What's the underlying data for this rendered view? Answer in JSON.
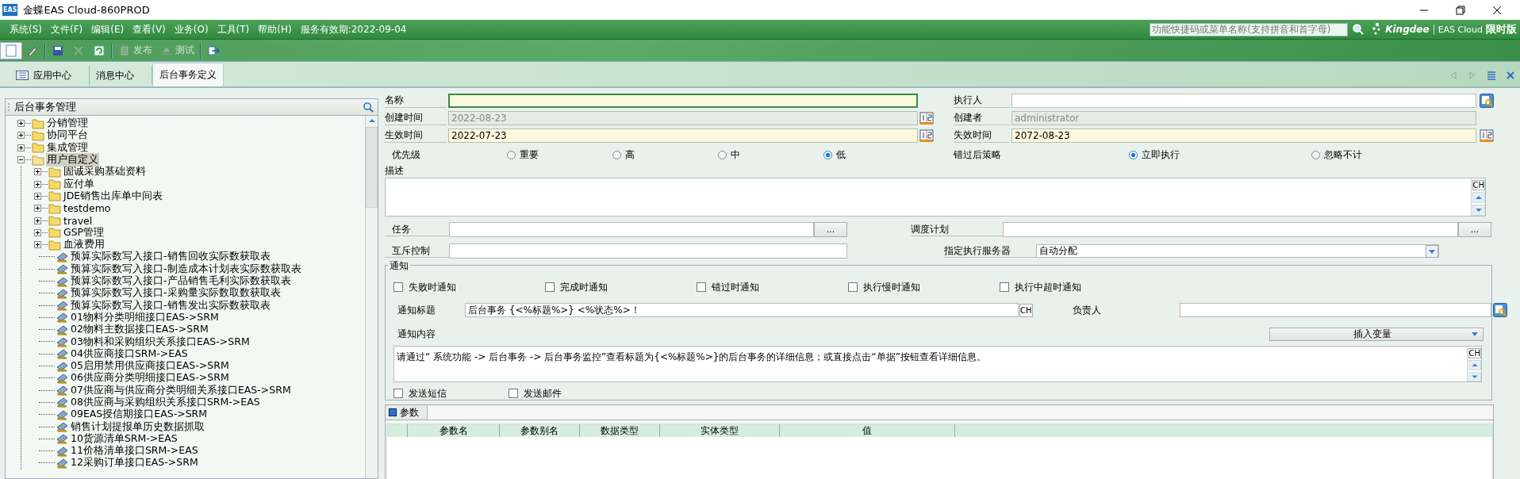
{
  "window": {
    "logo": "EAS",
    "title": "金蝶EAS Cloud-860PROD"
  },
  "menu": [
    "系统(S)",
    "文件(F)",
    "编辑(E)",
    "查看(V)",
    "业务(O)",
    "工具(T)",
    "帮助(H)"
  ],
  "service_expiry": "服务有效期:2022-09-04",
  "quick_search": {
    "placeholder": "功能快捷码或菜单名称(支持拼音和首字母)"
  },
  "brand": {
    "name": "Kingdee",
    "product": "EAS Cloud",
    "edition": "限时版"
  },
  "toolbar": [
    {
      "kind": "new",
      "disabled": false
    },
    {
      "kind": "edit",
      "disabled": false
    },
    {
      "kind": "save",
      "disabled": false
    },
    {
      "kind": "delete",
      "disabled": true
    },
    {
      "kind": "refresh",
      "disabled": false
    },
    {
      "kind": "publish",
      "label": "发布",
      "disabled": true
    },
    {
      "kind": "test",
      "label": "测试",
      "disabled": true
    },
    {
      "kind": "exit",
      "disabled": false
    }
  ],
  "tabs": [
    {
      "label": "应用中心",
      "kind": "app",
      "selected": false
    },
    {
      "label": "消息中心",
      "kind": "plain",
      "selected": false
    },
    {
      "label": "后台事务定义",
      "kind": "plain",
      "selected": true
    }
  ],
  "tree": {
    "title": "后台事务管理",
    "items": [
      {
        "label": "分销管理",
        "kind": "folder",
        "expanded": false,
        "selected": false
      },
      {
        "label": "协同平台",
        "kind": "folder",
        "expanded": false,
        "selected": false
      },
      {
        "label": "集成管理",
        "kind": "folder",
        "expanded": false,
        "selected": false
      },
      {
        "label": "用户自定义",
        "kind": "folder",
        "expanded": true,
        "selected": true,
        "children": [
          {
            "label": "固诚采购基础资料",
            "kind": "folder",
            "expanded": false,
            "selected": false
          },
          {
            "label": "应付单",
            "kind": "folder",
            "expanded": false,
            "selected": false
          },
          {
            "label": "JDE销售出库单中间表",
            "kind": "folder",
            "expanded": false,
            "selected": false
          },
          {
            "label": "testdemo",
            "kind": "folder",
            "expanded": false,
            "selected": false
          },
          {
            "label": "travel",
            "kind": "folder",
            "expanded": false,
            "selected": false
          },
          {
            "label": "GSP管理",
            "kind": "folder",
            "expanded": false,
            "selected": false
          },
          {
            "label": "血液费用",
            "kind": "folder",
            "expanded": false,
            "selected": false
          },
          {
            "label": "预算实际数写入接口-销售回收实际数获取表",
            "kind": "task",
            "selected": false
          },
          {
            "label": "预算实际数写入接口-制造成本计划表实际数获取表",
            "kind": "task",
            "selected": false
          },
          {
            "label": "预算实际数写入接口-产品销售毛利实际数获取表",
            "kind": "task",
            "selected": false
          },
          {
            "label": "预算实际数写入接口-采购量实际数取数获取表",
            "kind": "task",
            "selected": false
          },
          {
            "label": "预算实际数写入接口-销售发出实际数获取表",
            "kind": "task",
            "selected": false
          },
          {
            "label": "01物料分类明细接口EAS->SRM",
            "kind": "task",
            "selected": false
          },
          {
            "label": "02物料主数据接口EAS->SRM",
            "kind": "task",
            "selected": false
          },
          {
            "label": "03物料和采购组织关系接口EAS->SRM",
            "kind": "task",
            "selected": false
          },
          {
            "label": "04供应商接口SRM->EAS",
            "kind": "task",
            "selected": false
          },
          {
            "label": "05启用禁用供应商接口EAS->SRM",
            "kind": "task",
            "selected": false
          },
          {
            "label": "06供应商分类明细接口EAS->SRM",
            "kind": "task",
            "selected": false
          },
          {
            "label": "07供应商与供应商分类明细关系接口EAS->SRM",
            "kind": "task",
            "selected": false
          },
          {
            "label": "08供应商与采购组织关系接口SRM->EAS",
            "kind": "task",
            "selected": false
          },
          {
            "label": "09EAS授信期接口EAS->SRM",
            "kind": "task",
            "selected": false
          },
          {
            "label": "销售计划提报单历史数据抓取",
            "kind": "task",
            "selected": false
          },
          {
            "label": "10货源清单SRM->EAS",
            "kind": "task",
            "selected": false
          },
          {
            "label": "11价格清单接口SRM->EAS",
            "kind": "task",
            "selected": false
          },
          {
            "label": "12采购订单接口EAS->SRM",
            "kind": "task",
            "selected": false
          }
        ]
      }
    ]
  },
  "form": {
    "fields_left": [
      {
        "label": "名称",
        "kind": "text",
        "required": true,
        "readonly": false
      },
      {
        "label": "创建时间",
        "value": "2022-08-23",
        "kind": "date",
        "required": false,
        "readonly": true
      },
      {
        "label": "生效时间",
        "value": "2022-07-23",
        "kind": "date",
        "required": true,
        "readonly": false
      }
    ],
    "fields_right": [
      {
        "label": "执行人",
        "kind": "lookup",
        "required": false,
        "readonly": false
      },
      {
        "label": "创建者",
        "value": "administrator",
        "kind": "text",
        "required": false,
        "readonly": true
      },
      {
        "label": "失效时间",
        "value": "2072-08-23",
        "kind": "date",
        "required": true,
        "readonly": false
      }
    ],
    "priority": {
      "label": "优先级",
      "options": [
        {
          "label": "重要",
          "selected": false
        },
        {
          "label": "高",
          "selected": false
        },
        {
          "label": "中",
          "selected": false
        },
        {
          "label": "低",
          "selected": true
        }
      ]
    },
    "missed_policy": {
      "label": "错过后策略",
      "options": [
        {
          "label": "立即执行",
          "selected": true
        },
        {
          "label": "忽略不计",
          "selected": false
        }
      ]
    },
    "description": {
      "label": "描述",
      "lang_button": "CH"
    },
    "task": {
      "label": "任务",
      "button": "..."
    },
    "mutex": {
      "label": "互斥控制"
    },
    "schedule": {
      "label": "调度计划",
      "button": "..."
    },
    "server": {
      "label": "指定执行服务器",
      "value": "自动分配"
    }
  },
  "notify": {
    "title": "通知",
    "events": [
      {
        "label": "失败时通知",
        "checked": false
      },
      {
        "label": "完成时通知",
        "checked": false
      },
      {
        "label": "错过时通知",
        "checked": false
      },
      {
        "label": "执行慢时通知",
        "checked": false
      },
      {
        "label": "执行中超时通知",
        "checked": false
      }
    ],
    "subject": {
      "label": "通知标题",
      "value": "后台事务 {<%标题%>} <%状态%>！",
      "lang_button": "CH"
    },
    "owner": {
      "label": "负责人"
    },
    "content": {
      "label": "通知内容",
      "value": "请通过“ 系统功能 -> 后台事务 -> 后台事务监控”查看标题为{<%标题%>}的后台事务的详细信息；或直接点击“单据”按钮查看详细信息。",
      "lang_button": "CH"
    },
    "insert_button": "插入变量",
    "channels": [
      {
        "label": "发送短信",
        "checked": false
      },
      {
        "label": "发送邮件",
        "checked": false
      }
    ]
  },
  "params": {
    "title": "参数",
    "columns": [
      "参数名",
      "参数别名",
      "数据类型",
      "实体类型",
      "值"
    ]
  }
}
